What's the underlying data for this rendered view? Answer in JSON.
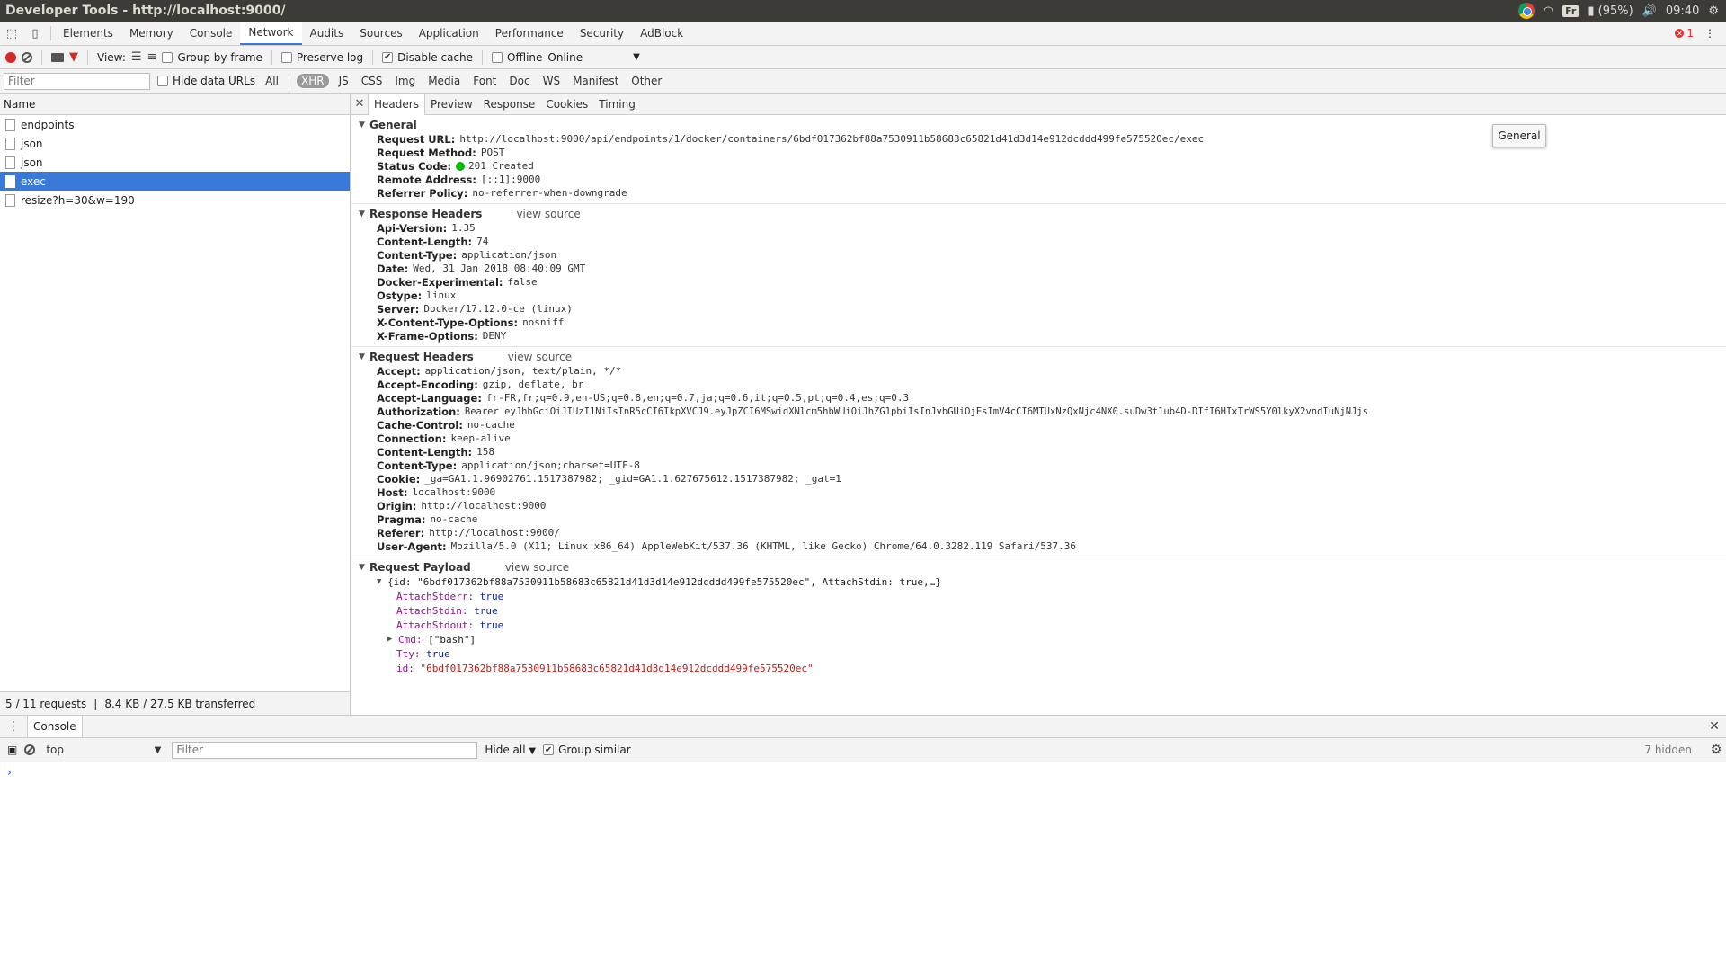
{
  "window": {
    "title": "Developer Tools - http://localhost:9000/",
    "tray": {
      "keyboard": "Fr",
      "battery": "(95%)",
      "time": "09:40"
    }
  },
  "main_tabs": [
    "Elements",
    "Memory",
    "Console",
    "Network",
    "Audits",
    "Sources",
    "Application",
    "Performance",
    "Security",
    "AdBlock"
  ],
  "active_main_tab": "Network",
  "error_count": "1",
  "net_toolbar": {
    "view_label": "View:",
    "group_by_frame": "Group by frame",
    "preserve_log": "Preserve log",
    "disable_cache": "Disable cache",
    "offline": "Offline",
    "throttle": "Online"
  },
  "filter_bar": {
    "placeholder": "Filter",
    "hide_data_urls": "Hide data URLs",
    "types": [
      "All",
      "XHR",
      "JS",
      "CSS",
      "Img",
      "Media",
      "Font",
      "Doc",
      "WS",
      "Manifest",
      "Other"
    ],
    "active_type": "XHR"
  },
  "requests": {
    "header": "Name",
    "items": [
      "endpoints",
      "json",
      "json",
      "exec",
      "resize?h=30&w=190"
    ],
    "selected": "exec",
    "status_count": "5 / 11 requests",
    "status_size": "8.4 KB / 27.5 KB transferred"
  },
  "detail_tabs": [
    "Headers",
    "Preview",
    "Response",
    "Cookies",
    "Timing"
  ],
  "active_detail_tab": "Headers",
  "tooltip": "General",
  "general": {
    "title": "General",
    "rows": [
      {
        "k": "Request URL:",
        "v": "http://localhost:9000/api/endpoints/1/docker/containers/6bdf017362bf88a7530911b58683c65821d41d3d14e912dcddd499fe575520ec/exec"
      },
      {
        "k": "Request Method:",
        "v": "POST"
      },
      {
        "k": "Status Code:",
        "v": "201 Created"
      },
      {
        "k": "Remote Address:",
        "v": "[::1]:9000"
      },
      {
        "k": "Referrer Policy:",
        "v": "no-referrer-when-downgrade"
      }
    ]
  },
  "response_headers": {
    "title": "Response Headers",
    "view_source": "view source",
    "rows": [
      {
        "k": "Api-Version:",
        "v": "1.35"
      },
      {
        "k": "Content-Length:",
        "v": "74"
      },
      {
        "k": "Content-Type:",
        "v": "application/json"
      },
      {
        "k": "Date:",
        "v": "Wed, 31 Jan 2018 08:40:09 GMT"
      },
      {
        "k": "Docker-Experimental:",
        "v": "false"
      },
      {
        "k": "Ostype:",
        "v": "linux"
      },
      {
        "k": "Server:",
        "v": "Docker/17.12.0-ce (linux)"
      },
      {
        "k": "X-Content-Type-Options:",
        "v": "nosniff"
      },
      {
        "k": "X-Frame-Options:",
        "v": "DENY"
      }
    ]
  },
  "request_headers": {
    "title": "Request Headers",
    "view_source": "view source",
    "rows": [
      {
        "k": "Accept:",
        "v": "application/json, text/plain, */*"
      },
      {
        "k": "Accept-Encoding:",
        "v": "gzip, deflate, br"
      },
      {
        "k": "Accept-Language:",
        "v": "fr-FR,fr;q=0.9,en-US;q=0.8,en;q=0.7,ja;q=0.6,it;q=0.5,pt;q=0.4,es;q=0.3"
      },
      {
        "k": "Authorization:",
        "v": "Bearer eyJhbGciOiJIUzI1NiIsInR5cCI6IkpXVCJ9.eyJpZCI6MSwidXNlcm5hbWUiOiJhZG1pbiIsInJvbGUiOjEsImV4cCI6MTUxNzQxNjc4NX0.suDw3t1ub4D-DIfI6HIxTrWS5Y0lkyX2vndIuNjNJjs"
      },
      {
        "k": "Cache-Control:",
        "v": "no-cache"
      },
      {
        "k": "Connection:",
        "v": "keep-alive"
      },
      {
        "k": "Content-Length:",
        "v": "158"
      },
      {
        "k": "Content-Type:",
        "v": "application/json;charset=UTF-8"
      },
      {
        "k": "Cookie:",
        "v": "_ga=GA1.1.96902761.1517387982; _gid=GA1.1.627675612.1517387982; _gat=1"
      },
      {
        "k": "Host:",
        "v": "localhost:9000"
      },
      {
        "k": "Origin:",
        "v": "http://localhost:9000"
      },
      {
        "k": "Pragma:",
        "v": "no-cache"
      },
      {
        "k": "Referer:",
        "v": "http://localhost:9000/"
      },
      {
        "k": "User-Agent:",
        "v": "Mozilla/5.0 (X11; Linux x86_64) AppleWebKit/537.36 (KHTML, like Gecko) Chrome/64.0.3282.119 Safari/537.36"
      }
    ]
  },
  "payload": {
    "title": "Request Payload",
    "view_source": "view source",
    "summary": "{id: \"6bdf017362bf88a7530911b58683c65821d41d3d14e912dcddd499fe575520ec\", AttachStdin: true,…}",
    "attach_stderr_k": "AttachStderr:",
    "attach_stderr_v": "true",
    "attach_stdin_k": "AttachStdin:",
    "attach_stdin_v": "true",
    "attach_stdout_k": "AttachStdout:",
    "attach_stdout_v": "true",
    "cmd_k": "Cmd:",
    "cmd_v": "[\"bash\"]",
    "tty_k": "Tty:",
    "tty_v": "true",
    "id_k": "id:",
    "id_v": "\"6bdf017362bf88a7530911b58683c65821d41d3d14e912dcddd499fe575520ec\""
  },
  "drawer": {
    "tab": "Console",
    "context": "top",
    "filter_placeholder": "Filter",
    "hide_all": "Hide all",
    "group_similar": "Group similar",
    "hidden_count": "7 hidden",
    "prompt": "›"
  },
  "colors": {
    "accent": "#3879d9",
    "record": "#d9281f",
    "status_ok": "#00bb00"
  }
}
